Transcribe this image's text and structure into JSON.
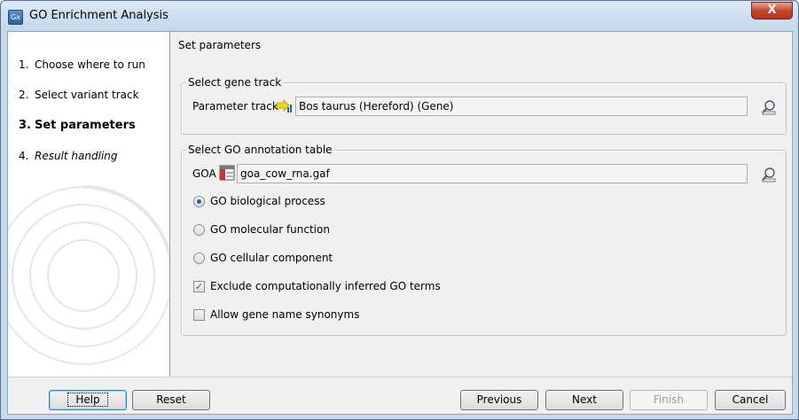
{
  "window": {
    "title": "GO Enrichment Analysis",
    "app_icon": "Gx",
    "close_glyph": "X"
  },
  "steps": [
    {
      "num": "1.",
      "label": "Choose where to run"
    },
    {
      "num": "2.",
      "label": "Select variant track"
    },
    {
      "num": "3.",
      "label": "Set parameters"
    },
    {
      "num": "4.",
      "label": "Result handling"
    }
  ],
  "main": {
    "section_title": "Set parameters",
    "gene_track_group": {
      "legend": "Select gene track",
      "param_label": "Parameter track",
      "value": "Bos taurus (Hereford)  (Gene)",
      "icon": "track-icon",
      "browse_icon": "browse-icon"
    },
    "go_group": {
      "legend": "Select GO annotation table",
      "goa_label": "GOA",
      "goa_value": "goa_cow_rna.gaf",
      "icon": "table-icon",
      "browse_icon": "browse-icon",
      "radios": [
        {
          "label": "GO biological process",
          "checked": true
        },
        {
          "label": "GO molecular function",
          "checked": false
        },
        {
          "label": "GO cellular component",
          "checked": false
        }
      ],
      "checkboxes": [
        {
          "label": "Exclude computationally inferred GO terms",
          "checked": true
        },
        {
          "label": "Allow gene name synonyms",
          "checked": false
        }
      ]
    }
  },
  "footer": {
    "help": "Help",
    "reset": "Reset",
    "previous": "Previous",
    "next": "Next",
    "finish": "Finish",
    "cancel": "Cancel"
  }
}
